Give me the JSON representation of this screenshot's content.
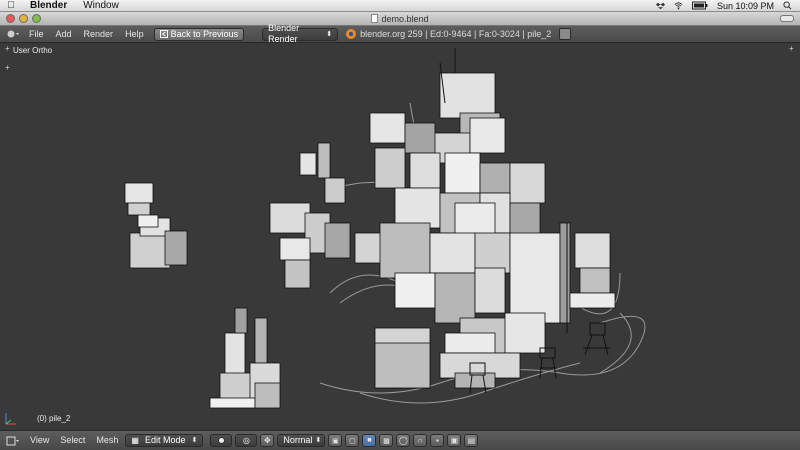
{
  "mac_menubar": {
    "app_name": "Blender",
    "menus": [
      "Window"
    ],
    "clock": "Sun 10:09 PM"
  },
  "window": {
    "title": "demo.blend"
  },
  "info_header": {
    "menus": [
      "File",
      "Add",
      "Render",
      "Help"
    ],
    "back_button": "Back to Previous",
    "render_engine": "Blender Render",
    "stats": "blender.org 259 | Ed:0-9464 | Fa:0-3024 | pile_2"
  },
  "viewport": {
    "view_label": "User Ortho",
    "object_label": "(0) pile_2"
  },
  "view_header": {
    "menus": [
      "View",
      "Select",
      "Mesh"
    ],
    "mode": "Edit Mode",
    "pivot": "Normal"
  },
  "colors": {
    "viewport_bg": "#393939",
    "header_bg": "#4a4a4a",
    "face_fill": "#cfcfcf",
    "edge": "#111111"
  },
  "icons": [
    "apple-icon",
    "dropbox-icon",
    "wifi-icon",
    "battery-icon",
    "blender-logo-icon",
    "editor-type-icon",
    "axes-gizmo-icon"
  ]
}
